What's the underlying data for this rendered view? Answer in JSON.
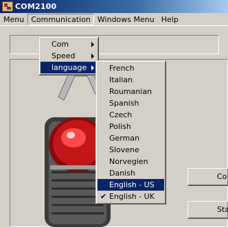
{
  "window": {
    "title": "COM2100"
  },
  "menubar": {
    "items": [
      "Menu",
      "Communication",
      "Windows Menu",
      "Help"
    ]
  },
  "communication_menu": {
    "items": [
      {
        "label": "Com",
        "has_submenu": true
      },
      {
        "label": "Speed",
        "has_submenu": true
      },
      {
        "label": "language",
        "has_submenu": true,
        "highlighted": true
      }
    ]
  },
  "language_menu": {
    "items": [
      {
        "label": "French"
      },
      {
        "label": "Italian"
      },
      {
        "label": "Roumanian"
      },
      {
        "label": "Spanish"
      },
      {
        "label": "Czech"
      },
      {
        "label": "Polish"
      },
      {
        "label": "German"
      },
      {
        "label": "Slovene"
      },
      {
        "label": "Norvegien"
      },
      {
        "label": "Danish"
      },
      {
        "label": "English - US",
        "highlighted": true
      },
      {
        "label": "English - UK",
        "checked": true
      }
    ]
  },
  "side_buttons": {
    "top_partial": "Co",
    "bottom_partial": "Sta"
  },
  "colors": {
    "highlight": "#0a246a",
    "face": "#d4d0c8",
    "title_start": "#0a246a",
    "title_end": "#a6caf0"
  }
}
